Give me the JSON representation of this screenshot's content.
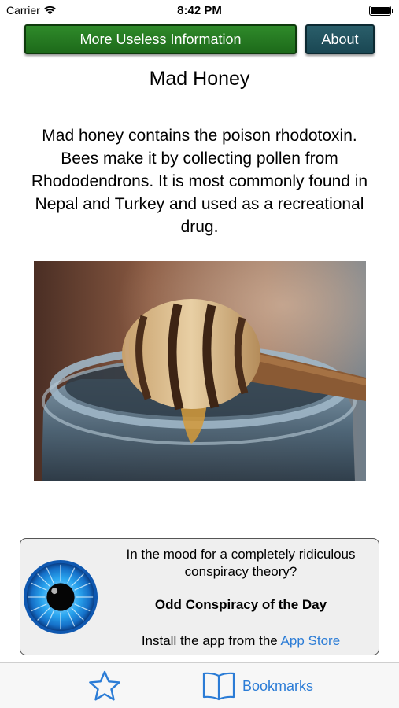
{
  "status_bar": {
    "carrier": "Carrier",
    "time": "8:42 PM"
  },
  "toolbar": {
    "more_label": "More Useless Information",
    "about_label": "About"
  },
  "article": {
    "title": "Mad Honey",
    "body": "Mad honey contains the poison rhodotoxin. Bees make it by collecting pollen from Rhododendrons. It is most commonly found in Nepal and Turkey and used as a recreational drug."
  },
  "ad": {
    "question_line1": "In the mood for a completely ridiculous",
    "question_line2": "conspiracy theory?",
    "app_name": "Odd Conspiracy of the Day",
    "install_prefix": "Install the app from the ",
    "install_link": "App Store"
  },
  "tab_bar": {
    "bookmarks_label": "Bookmarks"
  },
  "colors": {
    "more_button": "#2f8a2a",
    "about_button": "#2a5e6a",
    "link_blue": "#2b7cd6",
    "tab_bar_bg": "#f7f7f7"
  },
  "icons": {
    "wifi": "wifi-icon",
    "battery": "battery-icon",
    "eye": "eye-icon",
    "star": "star-icon",
    "book": "book-icon"
  }
}
